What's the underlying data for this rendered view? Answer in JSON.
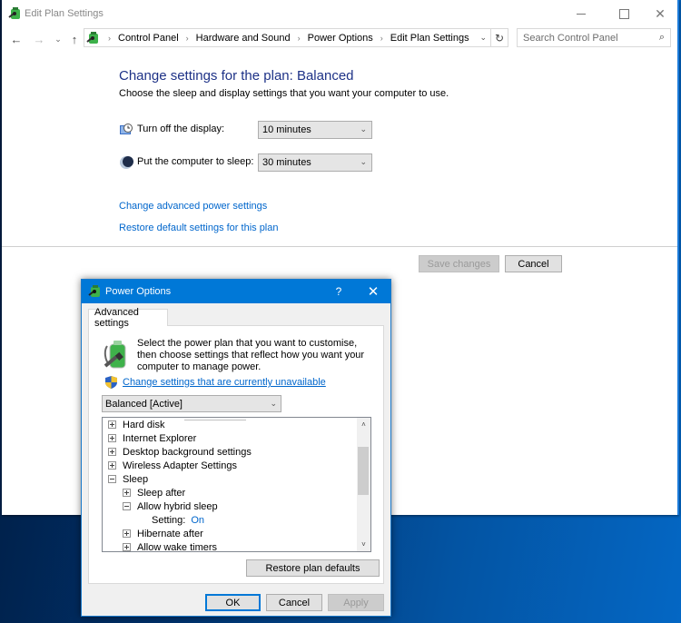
{
  "window": {
    "title": "Edit Plan Settings",
    "controls": {
      "minimize": "minimize",
      "maximize": "maximize",
      "close": "✕"
    }
  },
  "nav": {
    "back": "←",
    "forward": "→",
    "recent": "⌄",
    "up": "↑",
    "breadcrumbs": [
      "Control Panel",
      "Hardware and Sound",
      "Power Options",
      "Edit Plan Settings"
    ],
    "breadcrumb_separator": "›",
    "address_dropdown": "⌄",
    "refresh": "↻",
    "search_placeholder": "Search Control Panel",
    "search_icon": "⌕"
  },
  "main": {
    "title": "Change settings for the plan: Balanced",
    "subtitle": "Choose the sleep and display settings that you want your computer to use.",
    "settings": [
      {
        "icon": "monitor-clock-icon",
        "label": "Turn off the display:",
        "value": "10 minutes"
      },
      {
        "icon": "moon-icon",
        "label": "Put the computer to sleep:",
        "value": "30 minutes"
      }
    ],
    "links": {
      "advanced": "Change advanced power settings",
      "restore": "Restore default settings for this plan"
    },
    "buttons": {
      "save": "Save changes",
      "cancel": "Cancel"
    },
    "select_chevron": "⌄"
  },
  "dialog": {
    "title": "Power Options",
    "help": "?",
    "close": "✕",
    "tab": "Advanced settings",
    "intro": "Select the power plan that you want to customise, then choose settings that reflect how you want your computer to manage power.",
    "uac_link": "Change settings that are currently unavailable",
    "plan": "Balanced [Active]",
    "tree": [
      {
        "label": "Hard disk",
        "level": 0,
        "state": "collapsed"
      },
      {
        "label": "Internet Explorer",
        "level": 0,
        "state": "collapsed"
      },
      {
        "label": "Desktop background settings",
        "level": 0,
        "state": "collapsed"
      },
      {
        "label": "Wireless Adapter Settings",
        "level": 0,
        "state": "collapsed"
      },
      {
        "label": "Sleep",
        "level": 0,
        "state": "expanded"
      },
      {
        "label": "Sleep after",
        "level": 1,
        "state": "collapsed"
      },
      {
        "label": "Allow hybrid sleep",
        "level": 1,
        "state": "expanded"
      },
      {
        "label": "Setting:",
        "level": 2,
        "value": "On"
      },
      {
        "label": "Hibernate after",
        "level": 1,
        "state": "collapsed"
      },
      {
        "label": "Allow wake timers",
        "level": 1,
        "state": "collapsed"
      }
    ],
    "scroll": {
      "up": "˄",
      "down": "˅"
    },
    "buttons": {
      "restore_defaults": "Restore plan defaults",
      "ok": "OK",
      "cancel": "Cancel",
      "apply": "Apply"
    }
  },
  "colors": {
    "accent": "#0078d7",
    "title_text": "#1e3287",
    "link": "#0066cc"
  }
}
